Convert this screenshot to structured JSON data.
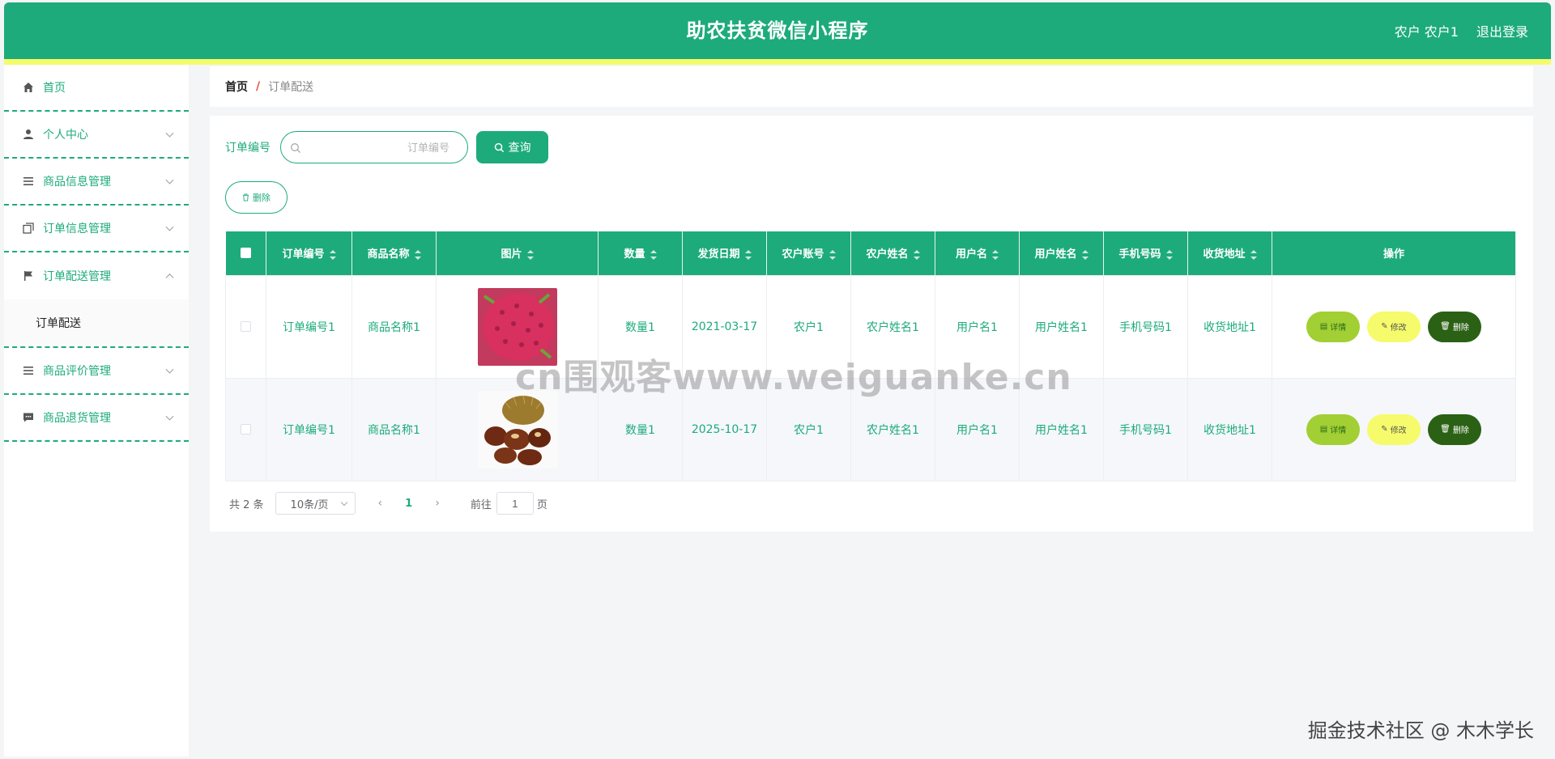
{
  "header": {
    "title": "助农扶贫微信小程序",
    "user": "农户 农户1",
    "logout": "退出登录",
    "bg_color": "#1dab7b",
    "stripe_color": "#f5fb6b"
  },
  "sidebar": {
    "items": [
      {
        "label": "首页",
        "icon": "home-icon"
      },
      {
        "label": "个人中心",
        "icon": "user-icon"
      },
      {
        "label": "商品信息管理",
        "icon": "list-icon"
      },
      {
        "label": "订单信息管理",
        "icon": "copy-icon"
      },
      {
        "label": "订单配送管理",
        "icon": "flag-icon",
        "expanded": true,
        "children": [
          "订单配送"
        ]
      },
      {
        "label": "商品评价管理",
        "icon": "list-icon"
      },
      {
        "label": "商品退货管理",
        "icon": "chat-icon"
      }
    ]
  },
  "breadcrumb": {
    "home": "首页",
    "separator": "/",
    "current": "订单配送"
  },
  "search": {
    "label": "订单编号",
    "placeholder": "订单编号",
    "button": "查询"
  },
  "toolbar": {
    "delete_label": "删除"
  },
  "table": {
    "columns": [
      "订单编号",
      "商品名称",
      "图片",
      "数量",
      "发货日期",
      "农户账号",
      "农户姓名",
      "用户名",
      "用户姓名",
      "手机号码",
      "收货地址",
      "操作"
    ],
    "rows": [
      {
        "order_no": "订单编号1",
        "product": "商品名称1",
        "image": "dragon-fruit",
        "qty": "数量1",
        "date": "2021-03-17",
        "farmer_acct": "农户1",
        "farmer_name": "农户姓名1",
        "username": "用户名1",
        "user_name": "用户姓名1",
        "phone": "手机号码1",
        "address": "收货地址1"
      },
      {
        "order_no": "订单编号1",
        "product": "商品名称1",
        "image": "chestnuts",
        "qty": "数量1",
        "date": "2025-10-17",
        "farmer_acct": "农户1",
        "farmer_name": "农户姓名1",
        "username": "用户名1",
        "user_name": "用户姓名1",
        "phone": "手机号码1",
        "address": "收货地址1"
      }
    ],
    "actions": {
      "detail": "详情",
      "edit": "修改",
      "delete": "删除"
    }
  },
  "pagination": {
    "total": "共 2 条",
    "page_size": "10条/页",
    "prev": "‹",
    "current_page": "1",
    "next": "›",
    "goto_label": "前往",
    "goto_value": "1",
    "page_suffix": "页"
  },
  "watermarks": {
    "center": "cn围观客www.weiguanke.cn",
    "corner": "掘金技术社区 @ 木木学长"
  }
}
